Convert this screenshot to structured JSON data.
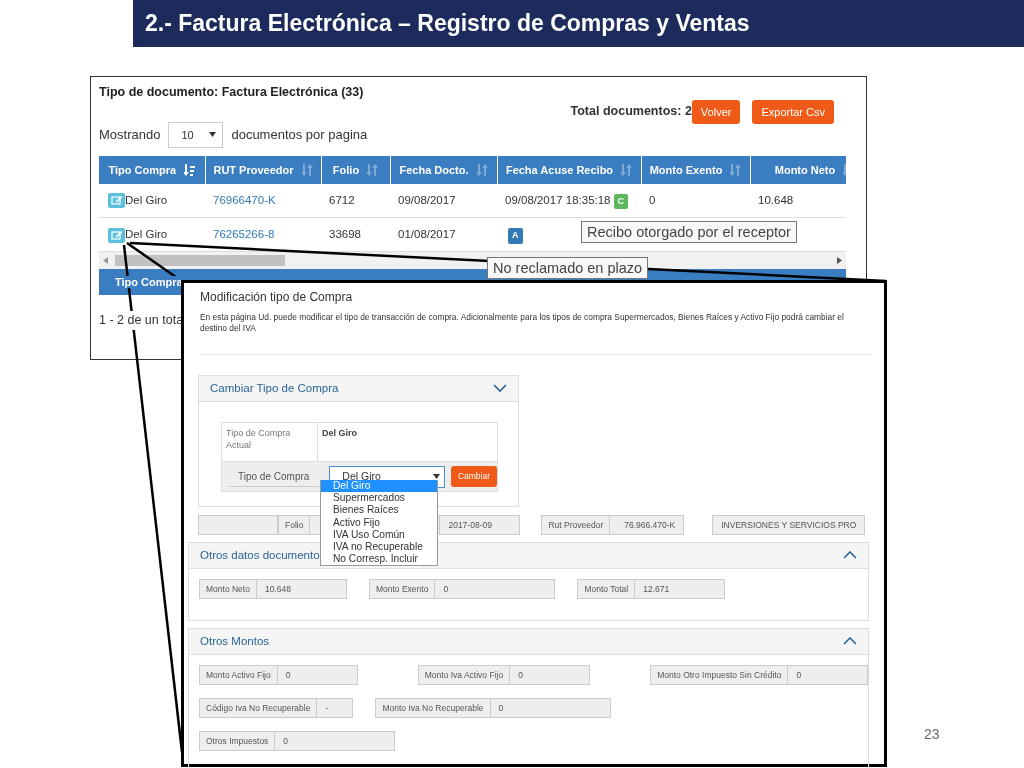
{
  "slide": {
    "title": "2.- Factura Electrónica – Registro de Compras y Ventas",
    "page_number": "23"
  },
  "document_list": {
    "title": "Tipo de documento: Factura Electrónica (33)",
    "total": "Total documentos: 2",
    "buttons": [
      "Volver",
      "Exportar Csv"
    ],
    "showing_label": "Mostrando",
    "page_size": "10",
    "showing_suffix": "documentos por pagina",
    "columns": [
      {
        "label": "Tipo Compra",
        "sorted": true
      },
      {
        "label": "RUT Proveedor",
        "sorted": false
      },
      {
        "label": "Folio",
        "sorted": false
      },
      {
        "label": "Fecha Docto.",
        "sorted": false
      },
      {
        "label": "Fecha Acuse Recibo",
        "sorted": false
      },
      {
        "label": "Monto Exento",
        "sorted": false
      },
      {
        "label": "Monto Neto",
        "sorted": false
      }
    ],
    "rows": [
      {
        "tipo": "Del Giro",
        "rut": "76966470-K",
        "folio": "6712",
        "fecha": "09/08/2017",
        "acuse": "09/08/2017 18:35:18",
        "badge": "C",
        "color": "#5cb85c",
        "exento": "0",
        "neto": "10.648"
      },
      {
        "tipo": "Del Giro",
        "rut": "76265266-8",
        "folio": "33698",
        "fecha": "01/08/2017",
        "badge": "A",
        "color": "#337ab7"
      }
    ],
    "footer_column": "Tipo Compra",
    "pagination": "1 - 2 de un tota",
    "tooltips": [
      "Recibo otorgado por el receptor",
      "No reclamado en plazo"
    ]
  },
  "modification": {
    "title": "Modificación tipo de Compra",
    "description": "En esta página Ud. puede modificar el tipo de transacción de compra. Adicionalmente para los tipos de compra Supermercados, Bienes Raíces y Activo Fijo podrá cambiar el destino del IVA",
    "change_panel": {
      "title": "Cambiar Tipo de Compra",
      "current_label": "Tipo de Compra Actual",
      "current_value": "Del Giro",
      "select_label": "Tipo de Compra",
      "select_value": "Del Giro",
      "button": "Cambiar",
      "options": [
        {
          "label": "Del Giro",
          "selected": true
        },
        {
          "label": "Supermercados",
          "selected": false
        },
        {
          "label": "Bienes Raíces",
          "selected": false
        },
        {
          "label": "Activo Fijo",
          "selected": false
        },
        {
          "label": "IVA Uso Común",
          "selected": false
        },
        {
          "label": "IVA no Recuperable",
          "selected": false
        },
        {
          "label": "No Corresp. Incluir",
          "selected": false
        }
      ]
    },
    "header_fields": {
      "folio_label": "Folio",
      "date": "2017-08-09",
      "rut_label": "Rut Proveedor",
      "rut": "76.966.470-K",
      "company": "INVERSIONES Y SERVICIOS PRO"
    },
    "sections": [
      {
        "title": "Otros datos documento",
        "rows": [
          [
            {
              "label": "Monto Neto",
              "value": "10.648"
            },
            {
              "label": "Monto Exento",
              "value": "0"
            },
            {
              "label": "Monto Total",
              "value": "12.671"
            }
          ]
        ]
      },
      {
        "title": "Otros Montos",
        "rows": [
          [
            {
              "label": "Monto Activo Fijo",
              "value": "0"
            },
            {
              "label": "Monto Iva Activo Fijo",
              "value": "0"
            },
            {
              "label": "Monto Otro Impuesto Sin Crédito",
              "value": "0"
            }
          ],
          [
            {
              "label": "Código Iva No Recuperable",
              "value": "-"
            },
            {
              "label": "Monto Iva No Recuperable",
              "value": "0"
            }
          ],
          [
            {
              "label": "Otros Impuestos",
              "value": "0"
            }
          ]
        ]
      }
    ]
  }
}
